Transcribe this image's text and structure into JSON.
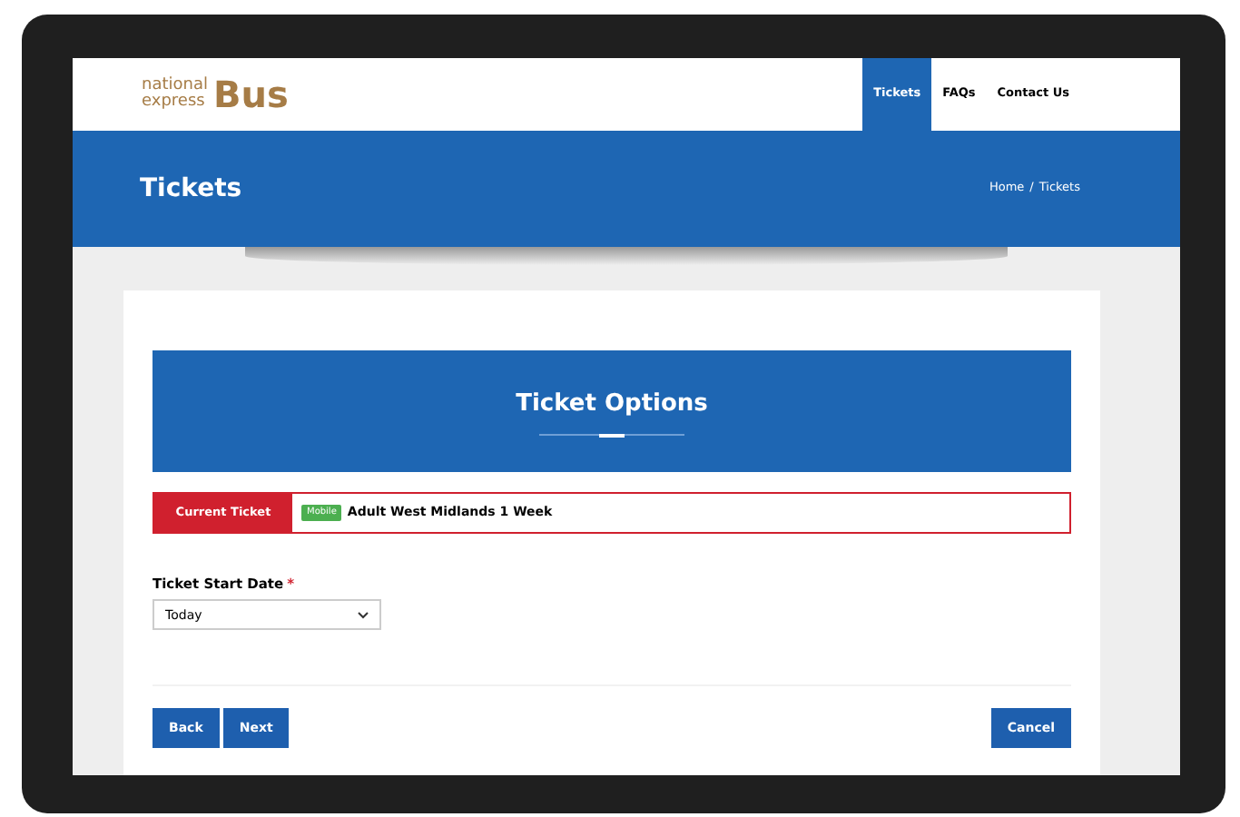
{
  "logo": {
    "line_1": "national",
    "line_2": "express",
    "wordmark": "Bus"
  },
  "nav": [
    {
      "label": "Tickets",
      "selected": true
    },
    {
      "label": "FAQs",
      "selected": false
    },
    {
      "label": "Contact Us",
      "selected": false
    }
  ],
  "page_title": "Tickets",
  "breadcrumb": [
    "Home",
    "/",
    "Tickets"
  ],
  "panel_title": "Ticket Options",
  "current_ticket": {
    "label": "Current Ticket",
    "badge": "Mobile",
    "name": "Adult West Midlands 1 Week"
  },
  "start_date": {
    "label": "Ticket Start Date",
    "required": true,
    "required_mark": "*",
    "value": "Today"
  },
  "buttons": [
    {
      "label": "Back",
      "kind": "left"
    },
    {
      "label": "Next",
      "kind": "left"
    },
    {
      "label": "Cancel",
      "kind": "right"
    }
  ]
}
